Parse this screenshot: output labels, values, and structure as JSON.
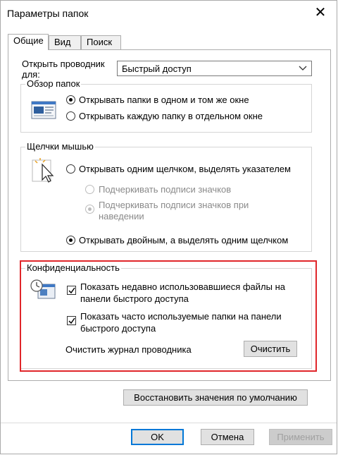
{
  "window": {
    "title": "Параметры папок",
    "close_glyph": "✕"
  },
  "tabs": [
    {
      "label": "Общие",
      "active": true
    },
    {
      "label": "Вид",
      "active": false
    },
    {
      "label": "Поиск",
      "active": false
    }
  ],
  "open_explorer": {
    "label_line1": "Открыть проводник",
    "label_line2": "для:",
    "selected": "Быстрый доступ"
  },
  "browse_folders": {
    "title": "Обзор папок",
    "options": [
      {
        "label": "Открывать папки в одном и том же окне",
        "selected": true
      },
      {
        "label": "Открывать каждую папку в отдельном окне",
        "selected": false
      }
    ]
  },
  "mouse_clicks": {
    "title": "Щелчки мышью",
    "single_click": "Открывать одним щелчком, выделять указателем",
    "underline_always": "Подчеркивать подписи значков",
    "underline_hover_line1": "Подчеркивать подписи значков при",
    "underline_hover_line2": "наведении",
    "double_click": "Открывать двойным, а выделять одним щелчком"
  },
  "privacy": {
    "title": "Конфиденциальность",
    "recent_files_line1": "Показать недавно использовавшиеся файлы на",
    "recent_files_line2": "панели быстрого доступа",
    "frequent_folders_line1": "Показать часто используемые папки на панели",
    "frequent_folders_line2": "быстрого доступа",
    "clear_label": "Очистить журнал проводника",
    "clear_button": "Очистить"
  },
  "restore_defaults": "Восстановить значения по умолчанию",
  "footer": {
    "ok": "OK",
    "cancel": "Отмена",
    "apply": "Применить"
  },
  "colors": {
    "highlight": "#e0262a",
    "focus": "#0078d7"
  }
}
